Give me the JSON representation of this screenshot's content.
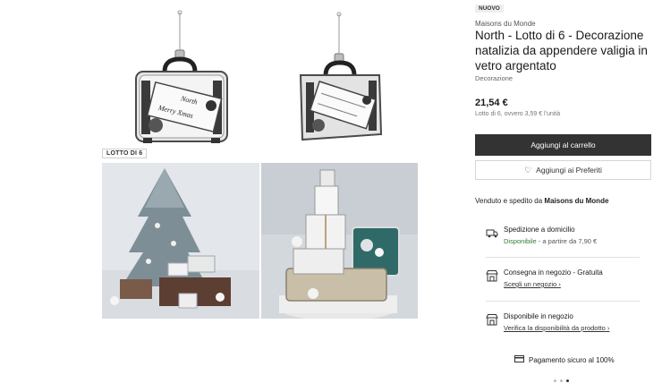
{
  "gallery": {
    "lot_badge": "LOTTO DI 6",
    "ornament_text_1": "North",
    "ornament_text_2": "Merry Xmas"
  },
  "product": {
    "new_badge": "NUOVO",
    "brand": "Maisons du Monde",
    "title": "North - Lotto di 6 - Decorazione natalizia da appendere valigia in vetro argentato",
    "category": "Decorazione",
    "price": "21,54 €",
    "unit_price": "Lotto di 6, ovvero 3,59 € l'unità"
  },
  "actions": {
    "add_to_cart": "Aggiungi al carrello",
    "add_to_favorites": "Aggiungi ai Preferiti"
  },
  "seller": {
    "prefix": "Venduto e spedito da ",
    "name": "Maisons du Monde"
  },
  "services": {
    "home_delivery": {
      "title": "Spedizione a domicilio",
      "status": "Disponibile",
      "detail": " - a partire da 7,90 €"
    },
    "store_delivery": {
      "title": "Consegna in negozio - Gratuita",
      "link": "Scegli un negozio"
    },
    "in_store": {
      "title": "Disponibile in negozio",
      "link": "Verifica la disponibilità da prodotto"
    }
  },
  "footer": {
    "secure_payment": "Pagamento sicuro al 100%"
  },
  "colors": {
    "primary_button": "#333333",
    "available_green": "#2e7d32"
  }
}
